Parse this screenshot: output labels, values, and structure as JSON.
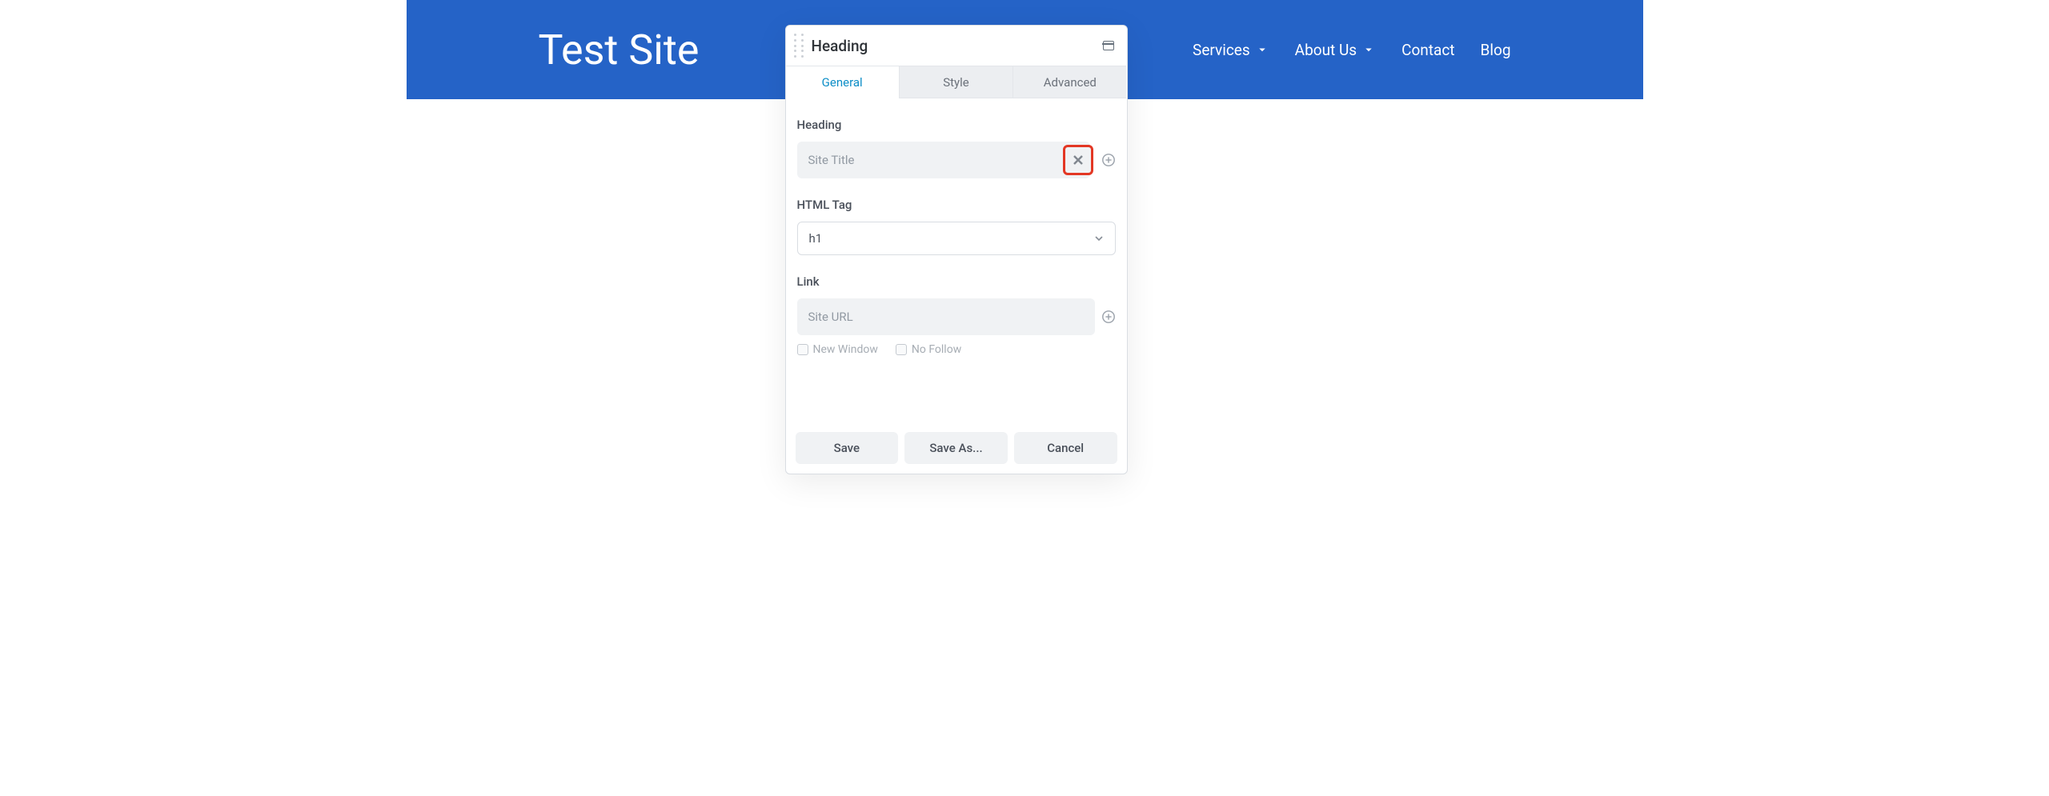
{
  "header": {
    "site_title": "Test Site",
    "nav": [
      {
        "label": "Services",
        "dropdown": true
      },
      {
        "label": "About Us",
        "dropdown": true
      },
      {
        "label": "Contact",
        "dropdown": false
      },
      {
        "label": "Blog",
        "dropdown": false
      }
    ]
  },
  "editor": {
    "title": "Heading",
    "tabs": {
      "general": "General",
      "style": "Style",
      "advanced": "Advanced",
      "active": "general"
    },
    "fields": {
      "heading": {
        "label": "Heading",
        "placeholder": "Site Title",
        "value": ""
      },
      "html_tag": {
        "label": "HTML Tag",
        "value": "h1"
      },
      "link": {
        "label": "Link",
        "placeholder": "Site URL",
        "value": "",
        "checkboxes": {
          "new_window": "New Window",
          "no_follow": "No Follow"
        }
      }
    },
    "buttons": {
      "save": "Save",
      "save_as": "Save As...",
      "cancel": "Cancel"
    }
  }
}
